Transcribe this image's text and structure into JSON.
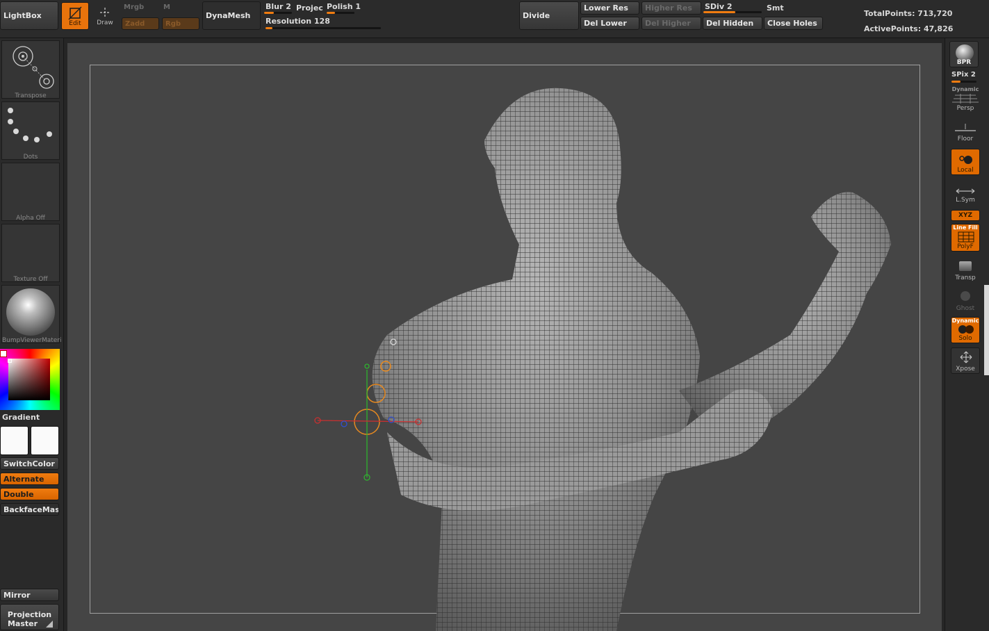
{
  "top_bar": {
    "lightbox": "LightBox",
    "edit": "Edit",
    "draw": "Draw",
    "mrgb": "Mrgb",
    "m": "M",
    "zadd": "Zadd",
    "rgb": "Rgb",
    "dynamesh": "DynaMesh",
    "blur": "Blur 2",
    "project": "Projec",
    "polish": "Polish 1",
    "resolution": "Resolution 128",
    "divide": "Divide",
    "lower_res": "Lower Res",
    "higher_res": "Higher Res",
    "sdiv": "SDiv 2",
    "smt": "Smt",
    "del_lower": "Del Lower",
    "del_higher": "Del Higher",
    "del_hidden": "Del Hidden",
    "close_holes": "Close Holes",
    "total_points": "TotalPoints: 713,720",
    "active_points": "ActivePoints: 47,826",
    "blur_level": 0.35,
    "polish_level": 0.3,
    "resolution_level": 0.06,
    "sdiv_level": 0.55
  },
  "left_panel": {
    "transpose": "Transpose",
    "dots": "Dots",
    "alpha": "Alpha  Off",
    "texture": "Texture  Off",
    "material": "BumpViewerMateri",
    "gradient": "Gradient",
    "switch_color": "SwitchColor",
    "alternate": "Alternate",
    "double": "Double",
    "backface_mask": "BackfaceMask",
    "mirror": "Mirror",
    "projection_master_1": "Projection",
    "projection_master_2": "Master"
  },
  "right_panel": {
    "bpr": "BPR",
    "spix": "SPix 2",
    "dynamic": "Dynamic",
    "persp": "Persp",
    "floor": "Floor",
    "local": "Local",
    "lsym": "L.Sym",
    "xyz": "XYZ",
    "line_fill": "Line Fill",
    "polyf": "PolyF",
    "transp": "Transp",
    "ghost": "Ghost",
    "dynamic2": "Dynamic",
    "solo": "Solo",
    "xpose": "Xpose",
    "spix_level": 0.35
  },
  "colors": {
    "accent": "#f07c10",
    "canvas": "#454545",
    "panel": "#2a2a2a"
  }
}
